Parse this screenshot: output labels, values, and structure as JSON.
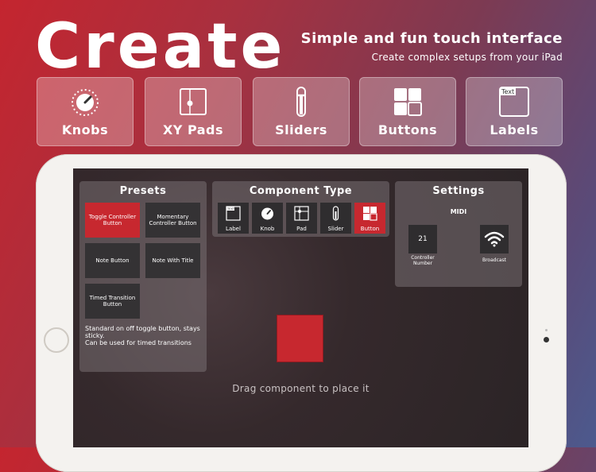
{
  "hero": {
    "title": "Create",
    "tagline": "Simple and fun touch interface",
    "subtagline": "Create complex setups from your iPad"
  },
  "features": [
    {
      "label": "Knobs",
      "icon": "knob-icon"
    },
    {
      "label": "XY Pads",
      "icon": "xy-pad-icon"
    },
    {
      "label": "Sliders",
      "icon": "slider-icon"
    },
    {
      "label": "Buttons",
      "icon": "buttons-grid-icon"
    },
    {
      "label": "Labels",
      "icon": "text-label-icon",
      "icon_text": "Text"
    }
  ],
  "presets": {
    "title": "Presets",
    "items": [
      {
        "label": "Toggle Controller Button",
        "active": true
      },
      {
        "label": "Momentary Controller Button",
        "active": false
      },
      {
        "label": "Note Button",
        "active": false
      },
      {
        "label": "Note With Title",
        "active": false
      },
      {
        "label": "Timed Transition Button",
        "active": false
      }
    ],
    "description": "Standard on off toggle button, stays sticky.\nCan be used for timed transitions"
  },
  "component_type": {
    "title": "Component Type",
    "items": [
      {
        "label": "Label",
        "icon": "label-icon",
        "icon_text": "TEXT",
        "active": false
      },
      {
        "label": "Knob",
        "icon": "knob-icon",
        "active": false
      },
      {
        "label": "Pad",
        "icon": "xy-pad-icon",
        "active": false
      },
      {
        "label": "Slider",
        "icon": "slider-icon",
        "active": false
      },
      {
        "label": "Button",
        "icon": "buttons-grid-icon",
        "active": true
      }
    ]
  },
  "settings": {
    "title": "Settings",
    "section": "MIDI",
    "controller_number": "21",
    "controller_number_label": "Controller Number",
    "broadcast_label": "Broadcast"
  },
  "canvas": {
    "hint": "Drag component to place it"
  },
  "colors": {
    "accent": "#c7282f",
    "bg_start": "#c4252f",
    "bg_end": "#4c5a8e"
  }
}
